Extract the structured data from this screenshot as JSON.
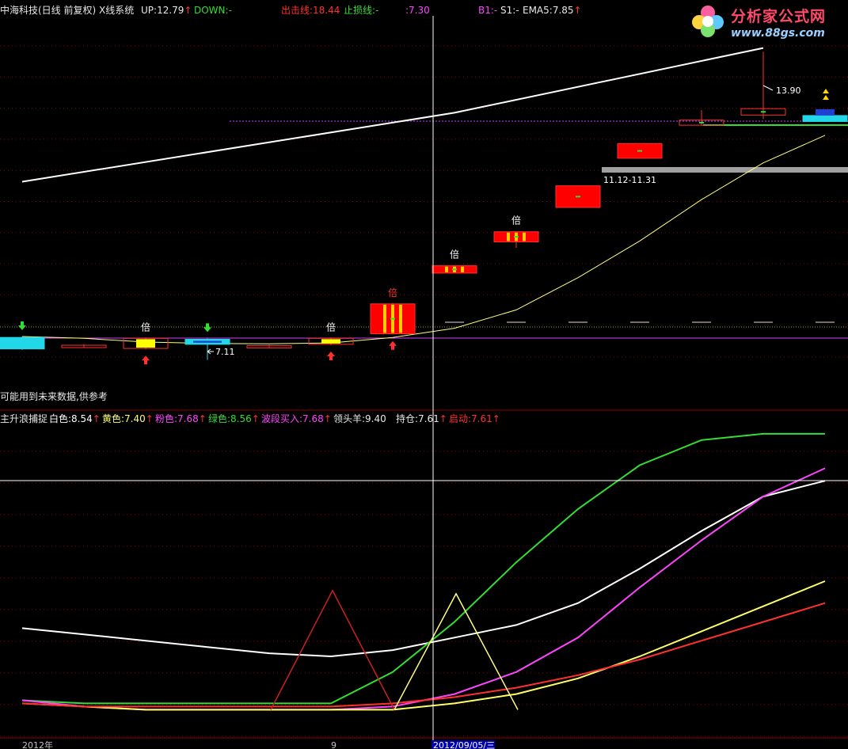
{
  "header": {
    "title": "中海科技(日线 前复权) X线系统",
    "up": "UP:12.79",
    "down": "DOWN:-",
    "exit_line": "出击线:18.44",
    "stop_loss": "止损线:-",
    "value_730": ":7.30",
    "b1": "B1:-",
    "s1": "S1:-",
    "ema5": "EMA5:7.85"
  },
  "logo": {
    "title": "分析家公式网",
    "url": "www.88gs.com"
  },
  "notice": "可能用到未来数据,供参考",
  "indicator_header": {
    "name": "主升浪捕捉",
    "white": "白色:8.54",
    "yellow": "黄色:7.40",
    "pink": "粉色:7.68",
    "green": "绿色:8.56",
    "band_buy": "波段买入:7.68",
    "leader": "领头羊:9.40",
    "hold": "持仓:7.61",
    "start": "启动:7.61"
  },
  "arrow_glyph": "↑",
  "x_axis": {
    "start_label": "2012年",
    "mid_label": "9",
    "cursor_date": "2012/09/05/三"
  },
  "chart_data": [
    {
      "type": "candlestick",
      "title": "",
      "ylim": [
        6.5,
        14.6
      ],
      "candles": [
        {
          "i": 0,
          "open": 7.35,
          "close": 7.6,
          "high": 7.62,
          "low": 7.33
        },
        {
          "i": 1,
          "open": 7.38,
          "close": 7.43,
          "high": 7.45,
          "low": 7.37
        },
        {
          "i": 2,
          "open": 7.36,
          "close": 7.58,
          "high": 7.6,
          "low": 7.34
        },
        {
          "i": 3,
          "open": 7.45,
          "close": 7.56,
          "high": 7.58,
          "low": 7.11
        },
        {
          "i": 4,
          "open": 7.38,
          "close": 7.42,
          "high": 7.44,
          "low": 7.36
        },
        {
          "i": 5,
          "open": 7.45,
          "close": 7.58,
          "high": 7.6,
          "low": 7.43
        },
        {
          "i": 6,
          "open": 7.68,
          "close": 8.33,
          "high": 8.35,
          "low": 7.66
        },
        {
          "i": 7,
          "open": 9.0,
          "close": 9.16,
          "high": 9.17,
          "low": 8.99
        },
        {
          "i": 8,
          "open": 9.68,
          "close": 9.9,
          "high": 9.91,
          "low": 9.55
        },
        {
          "i": 9,
          "open": 10.43,
          "close": 10.9,
          "high": 10.91,
          "low": 10.42
        },
        {
          "i": 10,
          "open": 11.5,
          "close": 11.82,
          "high": 11.83,
          "low": 11.49
        },
        {
          "i": 11,
          "open": 12.22,
          "close": 12.33,
          "high": 12.55,
          "low": 12.21
        },
        {
          "i": 12,
          "open": 12.44,
          "close": 12.58,
          "high": 13.82,
          "low": 12.35
        },
        {
          "i": 13,
          "open": 12.3,
          "close": 12.43,
          "high": 12.43,
          "low": 12.29
        }
      ],
      "markers": [
        {
          "i": 2,
          "label": "倍"
        },
        {
          "i": 5,
          "label": "倍"
        },
        {
          "i": 6,
          "label": "倍"
        },
        {
          "i": 7,
          "label": "倍"
        },
        {
          "i": 8,
          "label": "倍"
        }
      ],
      "annotations": [
        "13.90",
        "11.12-11.31",
        "7.11"
      ],
      "series": [
        {
          "color": "#ffffff",
          "values": [
            10.99,
            null,
            null,
            null,
            null,
            null,
            null,
            12.49,
            null,
            null,
            null,
            null,
            13.9,
            null
          ]
        },
        {
          "color": "#ffff80",
          "values": [
            7.62,
            7.58,
            7.5,
            7.47,
            7.46,
            7.48,
            7.6,
            7.8,
            8.2,
            8.9,
            9.7,
            10.6,
            11.4,
            12.0
          ]
        }
      ]
    },
    {
      "type": "line",
      "title": "",
      "ylim": [
        0,
        100
      ],
      "series": [
        {
          "name": "白色",
          "color": "#ffffff",
          "values": [
            35,
            33,
            31,
            29,
            27,
            26,
            28,
            32,
            36,
            43,
            54,
            66,
            77,
            82
          ]
        },
        {
          "name": "绿色",
          "color": "#33dd33",
          "values": [
            12,
            11,
            11,
            11,
            11,
            11,
            21,
            37,
            56,
            73,
            87,
            95,
            97,
            97
          ]
        },
        {
          "name": "粉色",
          "color": "#ff44ff",
          "values": [
            12,
            10,
            9,
            9,
            9,
            9,
            10,
            14,
            21,
            32,
            48,
            63,
            77,
            86
          ]
        },
        {
          "name": "黄色",
          "color": "#ffff66",
          "values": [
            11,
            10,
            9,
            9,
            9,
            9,
            9,
            11,
            14,
            19,
            26,
            34,
            42,
            50
          ]
        },
        {
          "name": "红色",
          "color": "#ff3030",
          "values": [
            11,
            10,
            10,
            10,
            10,
            10,
            11,
            13,
            16,
            20,
            25,
            31,
            37,
            43
          ]
        }
      ],
      "triangles": [
        {
          "color": "#cc2020",
          "peak": 47
        },
        {
          "color": "#ffff80",
          "peak": 46
        }
      ]
    }
  ]
}
